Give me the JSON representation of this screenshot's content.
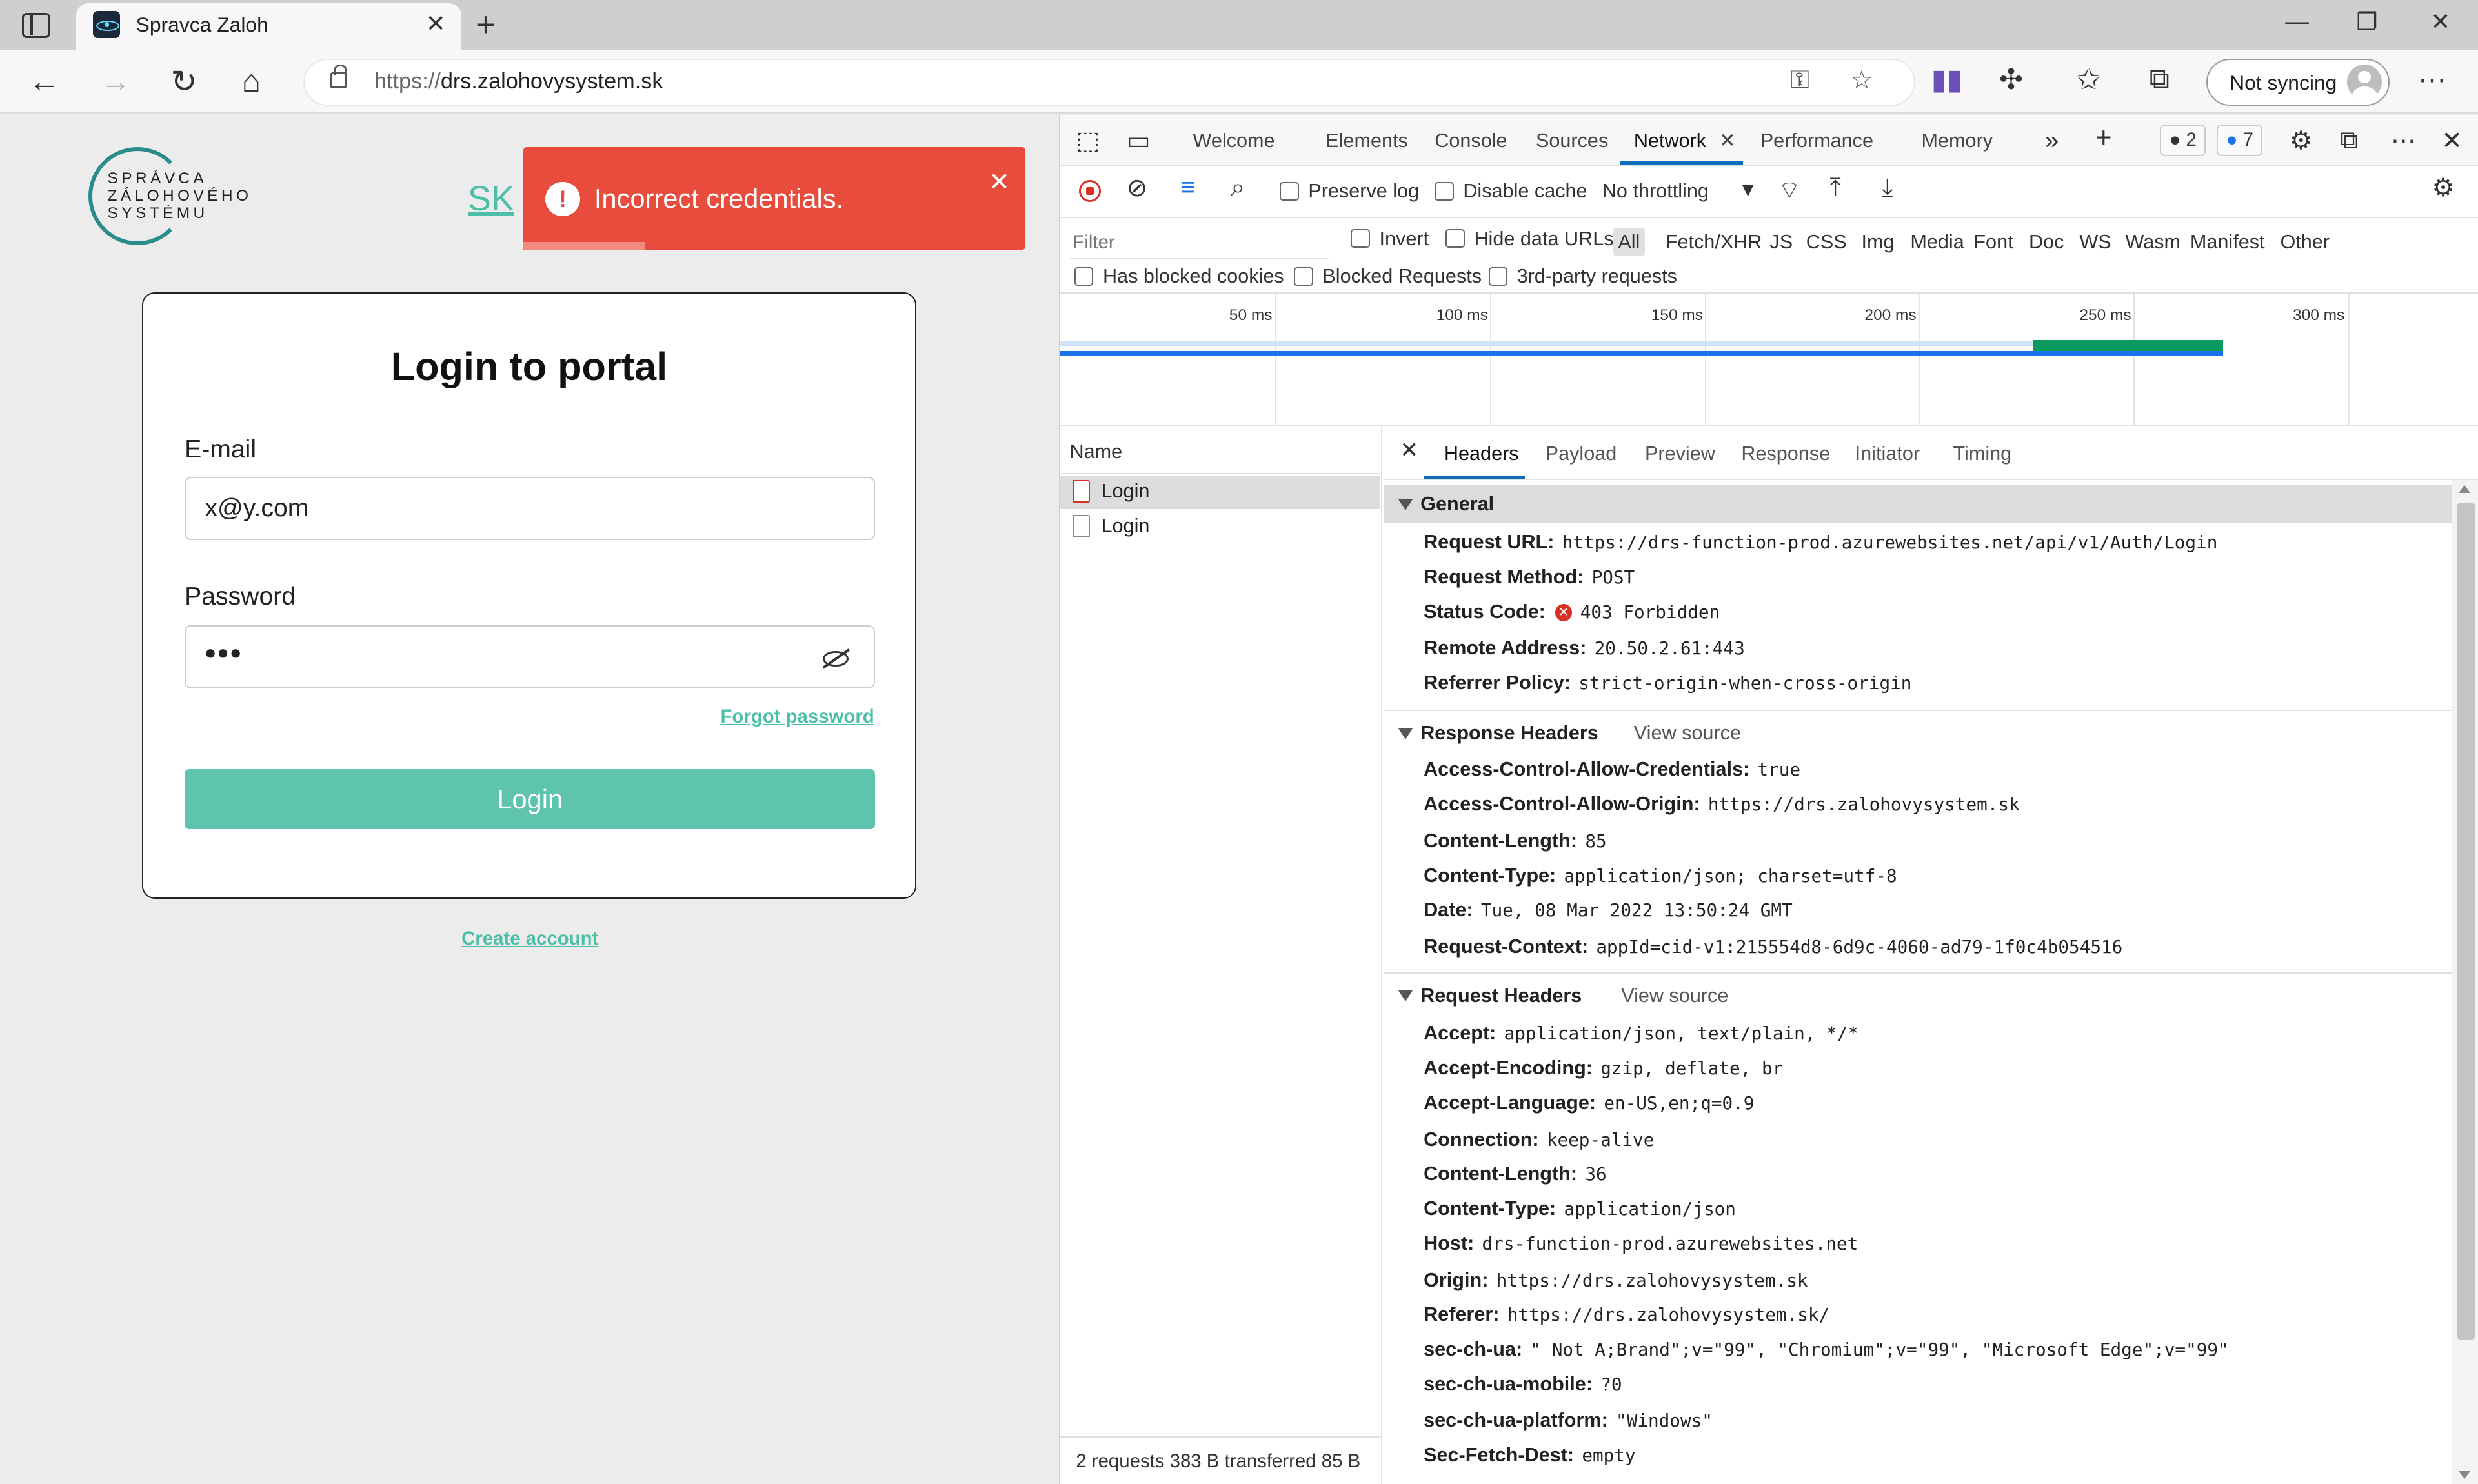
{
  "browser": {
    "tab_title": "Spravca Zaloh",
    "url_scheme": "https://",
    "url_host": "drs.zalohovysystem.sk",
    "sync_label": "Not syncing"
  },
  "page": {
    "logo_lines": [
      "SPRÁVCA",
      "ZÁLOHOVÉHO",
      "SYSTÉMU"
    ],
    "lang_link": "SK",
    "toast_message": "Incorrect credentials.",
    "login_title": "Login to portal",
    "email_label": "E-mail",
    "email_value": "x@y.com",
    "password_label": "Password",
    "password_value": "•••",
    "forgot_link": "Forgot password",
    "login_button": "Login",
    "create_link": "Create account"
  },
  "devtools": {
    "tabs": [
      "Welcome",
      "Elements",
      "Console",
      "Sources",
      "Network",
      "Performance",
      "Memory"
    ],
    "active_tab": "Network",
    "issues_badge": "2",
    "messages_badge": "7",
    "preserve_log": "Preserve log",
    "disable_cache": "Disable cache",
    "throttling": "No throttling",
    "filter_placeholder": "Filter",
    "invert": "Invert",
    "hide_data_urls": "Hide data URLs",
    "filter_types": [
      "All",
      "Fetch/XHR",
      "JS",
      "CSS",
      "Img",
      "Media",
      "Font",
      "Doc",
      "WS",
      "Wasm",
      "Manifest",
      "Other"
    ],
    "has_blocked_cookies": "Has blocked cookies",
    "blocked_requests": "Blocked Requests",
    "third_party": "3rd-party requests",
    "timeline_ticks": [
      "50 ms",
      "100 ms",
      "150 ms",
      "200 ms",
      "250 ms",
      "300 ms"
    ],
    "name_header": "Name",
    "requests": [
      "Login",
      "Login"
    ],
    "footer": "2 requests   383 B transferred   85 B",
    "detail_tabs": [
      "Headers",
      "Payload",
      "Preview",
      "Response",
      "Initiator",
      "Timing"
    ],
    "general_title": "General",
    "general": [
      {
        "k": "Request URL:",
        "v": "https://drs-function-prod.azurewebsites.net/api/v1/Auth/Login"
      },
      {
        "k": "Request Method:",
        "v": "POST"
      },
      {
        "k": "Status Code:",
        "v": "403 Forbidden"
      },
      {
        "k": "Remote Address:",
        "v": "20.50.2.61:443"
      },
      {
        "k": "Referrer Policy:",
        "v": "strict-origin-when-cross-origin"
      }
    ],
    "response_title": "Response Headers",
    "view_source": "View source",
    "response_headers": [
      {
        "k": "Access-Control-Allow-Credentials:",
        "v": "true"
      },
      {
        "k": "Access-Control-Allow-Origin:",
        "v": "https://drs.zalohovysystem.sk"
      },
      {
        "k": "Content-Length:",
        "v": "85"
      },
      {
        "k": "Content-Type:",
        "v": "application/json; charset=utf-8"
      },
      {
        "k": "Date:",
        "v": "Tue, 08 Mar 2022 13:50:24 GMT"
      },
      {
        "k": "Request-Context:",
        "v": "appId=cid-v1:215554d8-6d9c-4060-ad79-1f0c4b054516"
      }
    ],
    "request_title": "Request Headers",
    "request_headers": [
      {
        "k": "Accept:",
        "v": "application/json, text/plain, */*"
      },
      {
        "k": "Accept-Encoding:",
        "v": "gzip, deflate, br"
      },
      {
        "k": "Accept-Language:",
        "v": "en-US,en;q=0.9"
      },
      {
        "k": "Connection:",
        "v": "keep-alive"
      },
      {
        "k": "Content-Length:",
        "v": "36"
      },
      {
        "k": "Content-Type:",
        "v": "application/json"
      },
      {
        "k": "Host:",
        "v": "drs-function-prod.azurewebsites.net"
      },
      {
        "k": "Origin:",
        "v": "https://drs.zalohovysystem.sk"
      },
      {
        "k": "Referer:",
        "v": "https://drs.zalohovysystem.sk/"
      },
      {
        "k": "sec-ch-ua:",
        "v": "\" Not A;Brand\";v=\"99\", \"Chromium\";v=\"99\", \"Microsoft Edge\";v=\"99\""
      },
      {
        "k": "sec-ch-ua-mobile:",
        "v": "?0"
      },
      {
        "k": "sec-ch-ua-platform:",
        "v": "\"Windows\""
      },
      {
        "k": "Sec-Fetch-Dest:",
        "v": "empty"
      }
    ]
  }
}
